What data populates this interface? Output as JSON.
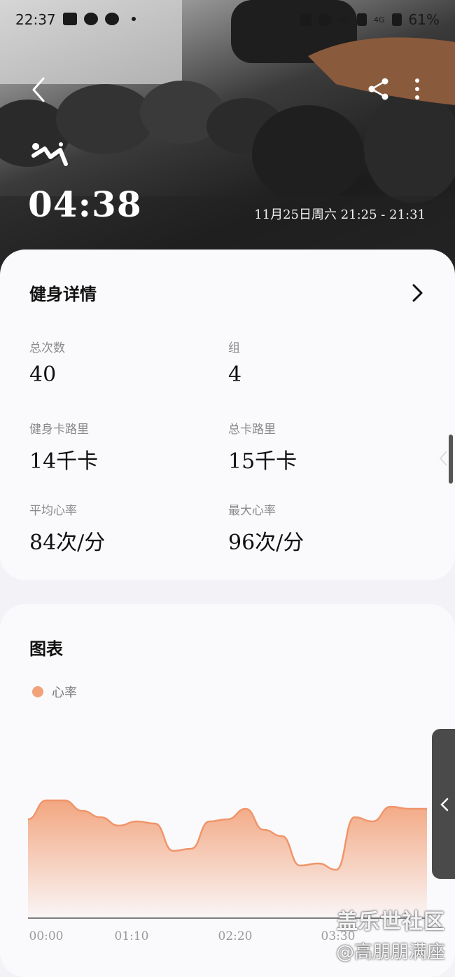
{
  "status_bar": {
    "time": "22:37",
    "network_labels": [
      "HD",
      "4G"
    ],
    "battery": "61%"
  },
  "header": {
    "icons": [
      "back-icon",
      "share-icon",
      "more-icon",
      "workout-icon"
    ],
    "duration": "04:38",
    "date_range": "11月25日周六 21:25 - 21:31"
  },
  "details": {
    "title": "健身详情",
    "stats": {
      "total_reps": {
        "label": "总次数",
        "value": "40"
      },
      "sets": {
        "label": "组",
        "value": "4"
      },
      "workout_calories": {
        "label": "健身卡路里",
        "value": "14千卡"
      },
      "total_calories": {
        "label": "总卡路里",
        "value": "15千卡"
      },
      "avg_hr": {
        "label": "平均心率",
        "value": "84次/分"
      },
      "max_hr": {
        "label": "最大心率",
        "value": "96次/分"
      }
    }
  },
  "chart_section": {
    "title": "图表",
    "legend": "心率",
    "accent_color": "#f2a27a"
  },
  "chart_data": {
    "type": "area",
    "title": "",
    "xlabel": "",
    "ylabel": "",
    "x_ticks": [
      "00:00",
      "01:10",
      "02:20",
      "03:30"
    ],
    "series": [
      {
        "name": "心率",
        "values": [
          87,
          96,
          96,
          91,
          88,
          84,
          86,
          85,
          72,
          73,
          86,
          87,
          92,
          82,
          79,
          65,
          66,
          63,
          88,
          86,
          93,
          92,
          92
        ]
      }
    ]
  },
  "watermark": {
    "line1": "盖乐世社区",
    "line2": "@高朋朋满座"
  }
}
